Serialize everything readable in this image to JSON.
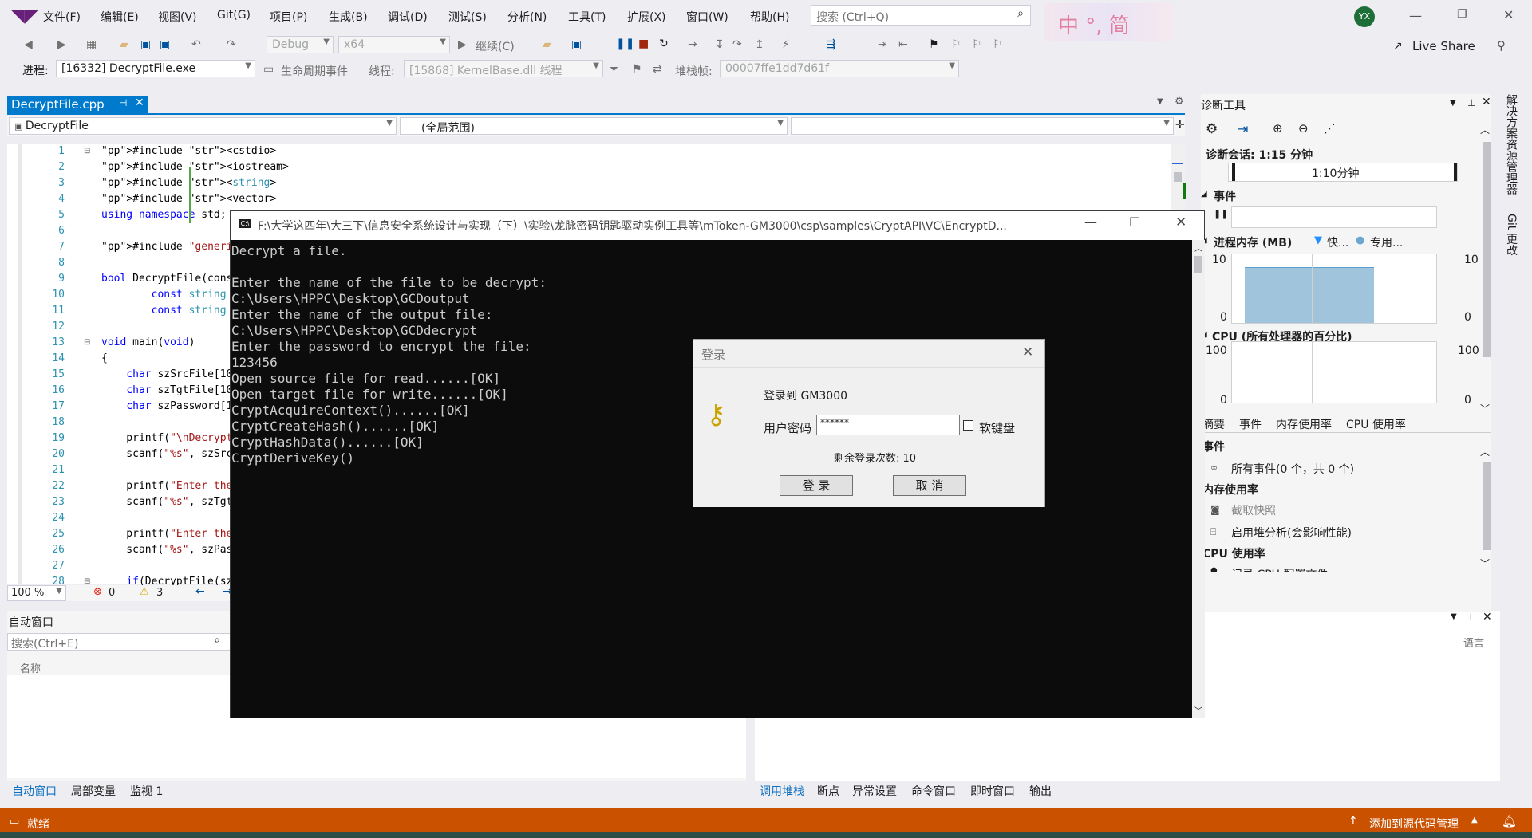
{
  "menubar": {
    "items": [
      "文件(F)",
      "编辑(E)",
      "视图(V)",
      "Git(G)",
      "项目(P)",
      "生成(B)",
      "调试(D)",
      "测试(S)",
      "分析(N)",
      "工具(T)",
      "扩展(X)",
      "窗口(W)",
      "帮助(H)"
    ],
    "search_placeholder": "搜索 (Ctrl+Q)",
    "ime_text": "中 °, 简",
    "user_initials": "YX",
    "live_share": "Live Share"
  },
  "toolbar": {
    "config": "Debug",
    "platform": "x64",
    "continue_label": "继续(C)",
    "process_label": "进程:",
    "process_value": "[16332] DecryptFile.exe",
    "lifecycle_label": "生命周期事件",
    "thread_label": "线程:",
    "thread_value": "[15868] KernelBase.dll 线程",
    "stack_label": "堆栈帧:",
    "stack_value": "00007ffe1dd7d61f"
  },
  "editor": {
    "tab_title": "DecryptFile.cpp",
    "scope_left": "DecryptFile",
    "scope_mid": "(全局范围)",
    "zoom": "100 %",
    "errors": "0",
    "warnings": "3",
    "line_numbers": [
      "1",
      "2",
      "3",
      "4",
      "5",
      "6",
      "7",
      "8",
      "9",
      "10",
      "11",
      "12",
      "13",
      "14",
      "15",
      "16",
      "17",
      "18",
      "19",
      "20",
      "21",
      "22",
      "23",
      "24",
      "25",
      "26",
      "27",
      "28"
    ],
    "lines": [
      "#include <cstdio>",
      "#include <iostream>",
      "#include <string>",
      "#include <vector>",
      "using namespace std;",
      "",
      "#include \"generic.h\"",
      "",
      "bool DecryptFile(cons",
      "        const string ",
      "        const string ",
      "",
      "void main(void)",
      "{",
      "    char szSrcFile[10",
      "    char szTgtFile[10",
      "    char szPassword[1",
      "",
      "    printf(\"\\nDecrypt",
      "    scanf(\"%s\", szSrc",
      "",
      "    printf(\"Enter the",
      "    scanf(\"%s\", szTgt",
      "",
      "    printf(\"Enter the",
      "    scanf(\"%s\", szPas",
      "",
      "    if(DecryptFile(sz"
    ]
  },
  "console": {
    "title": "F:\\大学这四年\\大三下\\信息安全系统设计与实现（下）\\实验\\龙脉密码钥匙驱动实例工具等\\mToken-GM3000\\csp\\samples\\CryptAPI\\VC\\EncryptD...",
    "output": "Decrypt a file.\n\nEnter the name of the file to be decrypt:\nC:\\Users\\HPPC\\Desktop\\GCDoutput\nEnter the name of the output file:\nC:\\Users\\HPPC\\Desktop\\GCDdecrypt\nEnter the password to encrypt the file:\n123456\nOpen source file for read......[OK]\nOpen target file for write......[OK]\nCryptAcquireContext()......[OK]\nCryptCreateHash()......[OK]\nCryptHashData()......[OK]\nCryptDeriveKey()"
  },
  "login": {
    "title": "登录",
    "login_to": "登录到  GM3000",
    "pin_label": "用户密码",
    "pin_value": "******",
    "softkb_label": "软键盘",
    "remaining": "剩余登录次数: 10",
    "ok": "登 录",
    "cancel": "取 消"
  },
  "diag": {
    "title": "诊断工具",
    "session": "诊断会话: 1:15 分钟",
    "timeline_label": "1:10分钟",
    "events_label": "事件",
    "memory_label": "进程内存 (MB)",
    "legend_fast": "快...",
    "legend_private": "专用...",
    "mem_max_left": "10",
    "mem_max_right": "10",
    "mem_min_left": "0",
    "mem_min_right": "0",
    "cpu_label": "CPU (所有处理器的百分比)",
    "cpu_max_left": "100",
    "cpu_max_right": "100",
    "cpu_min_left": "0",
    "cpu_min_right": "0",
    "tabs": [
      "摘要",
      "事件",
      "内存使用率",
      "CPU 使用率"
    ],
    "sec_events": "事件",
    "all_events": "所有事件(0 个，共 0 个)",
    "sec_memory": "内存使用率",
    "snapshot": "截取快照",
    "heap": "启用堆分析(会影响性能)",
    "sec_cpu": "CPU 使用率",
    "record_cpu": "记录 CPU 配置文件",
    "memory_series": {
      "fraction_of_max": 0.8
    }
  },
  "side_tabs": [
    "解决方案资源管理器",
    "Git 更改"
  ],
  "autos": {
    "title": "自动窗口",
    "search_placeholder": "搜索(Ctrl+E)",
    "column_name": "名称",
    "tabs": [
      "自动窗口",
      "局部变量",
      "监视 1"
    ]
  },
  "callstack": {
    "column_lang": "语言",
    "tabs": [
      "调用堆栈",
      "断点",
      "异常设置",
      "命令窗口",
      "即时窗口",
      "输出"
    ]
  },
  "status": {
    "ready": "就绪",
    "add_source": "添加到源代码管理"
  }
}
